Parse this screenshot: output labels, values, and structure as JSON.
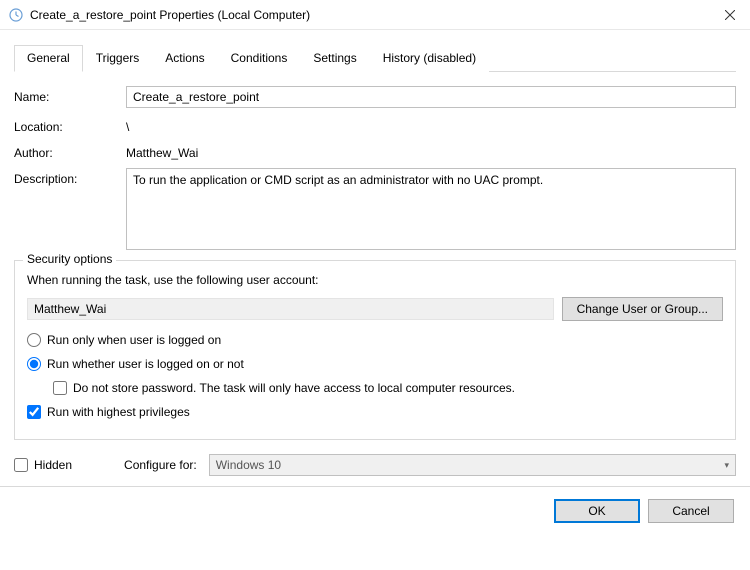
{
  "window": {
    "title": "Create_a_restore_point Properties (Local Computer)"
  },
  "tabs": {
    "general": "General",
    "triggers": "Triggers",
    "actions": "Actions",
    "conditions": "Conditions",
    "settings": "Settings",
    "history": "History (disabled)"
  },
  "labels": {
    "name": "Name:",
    "location": "Location:",
    "author": "Author:",
    "description": "Description:",
    "security_options": "Security options",
    "when_running": "When running the task, use the following user account:",
    "change_user": "Change User or Group...",
    "run_logged_on": "Run only when user is logged on",
    "run_whether": "Run whether user is logged on or not",
    "do_not_store": "Do not store password.  The task will only have access to local computer resources.",
    "run_highest": "Run with highest privileges",
    "hidden": "Hidden",
    "configure_for": "Configure for:",
    "ok": "OK",
    "cancel": "Cancel"
  },
  "values": {
    "name": "Create_a_restore_point",
    "location": "\\",
    "author": "Matthew_Wai",
    "description": "To run the application or CMD script as an administrator with no UAC prompt.",
    "user_account": "Matthew_Wai",
    "configure_for": "Windows 10"
  },
  "state": {
    "radio_selected": "whether",
    "do_not_store_checked": false,
    "run_highest_checked": true,
    "hidden_checked": false
  }
}
